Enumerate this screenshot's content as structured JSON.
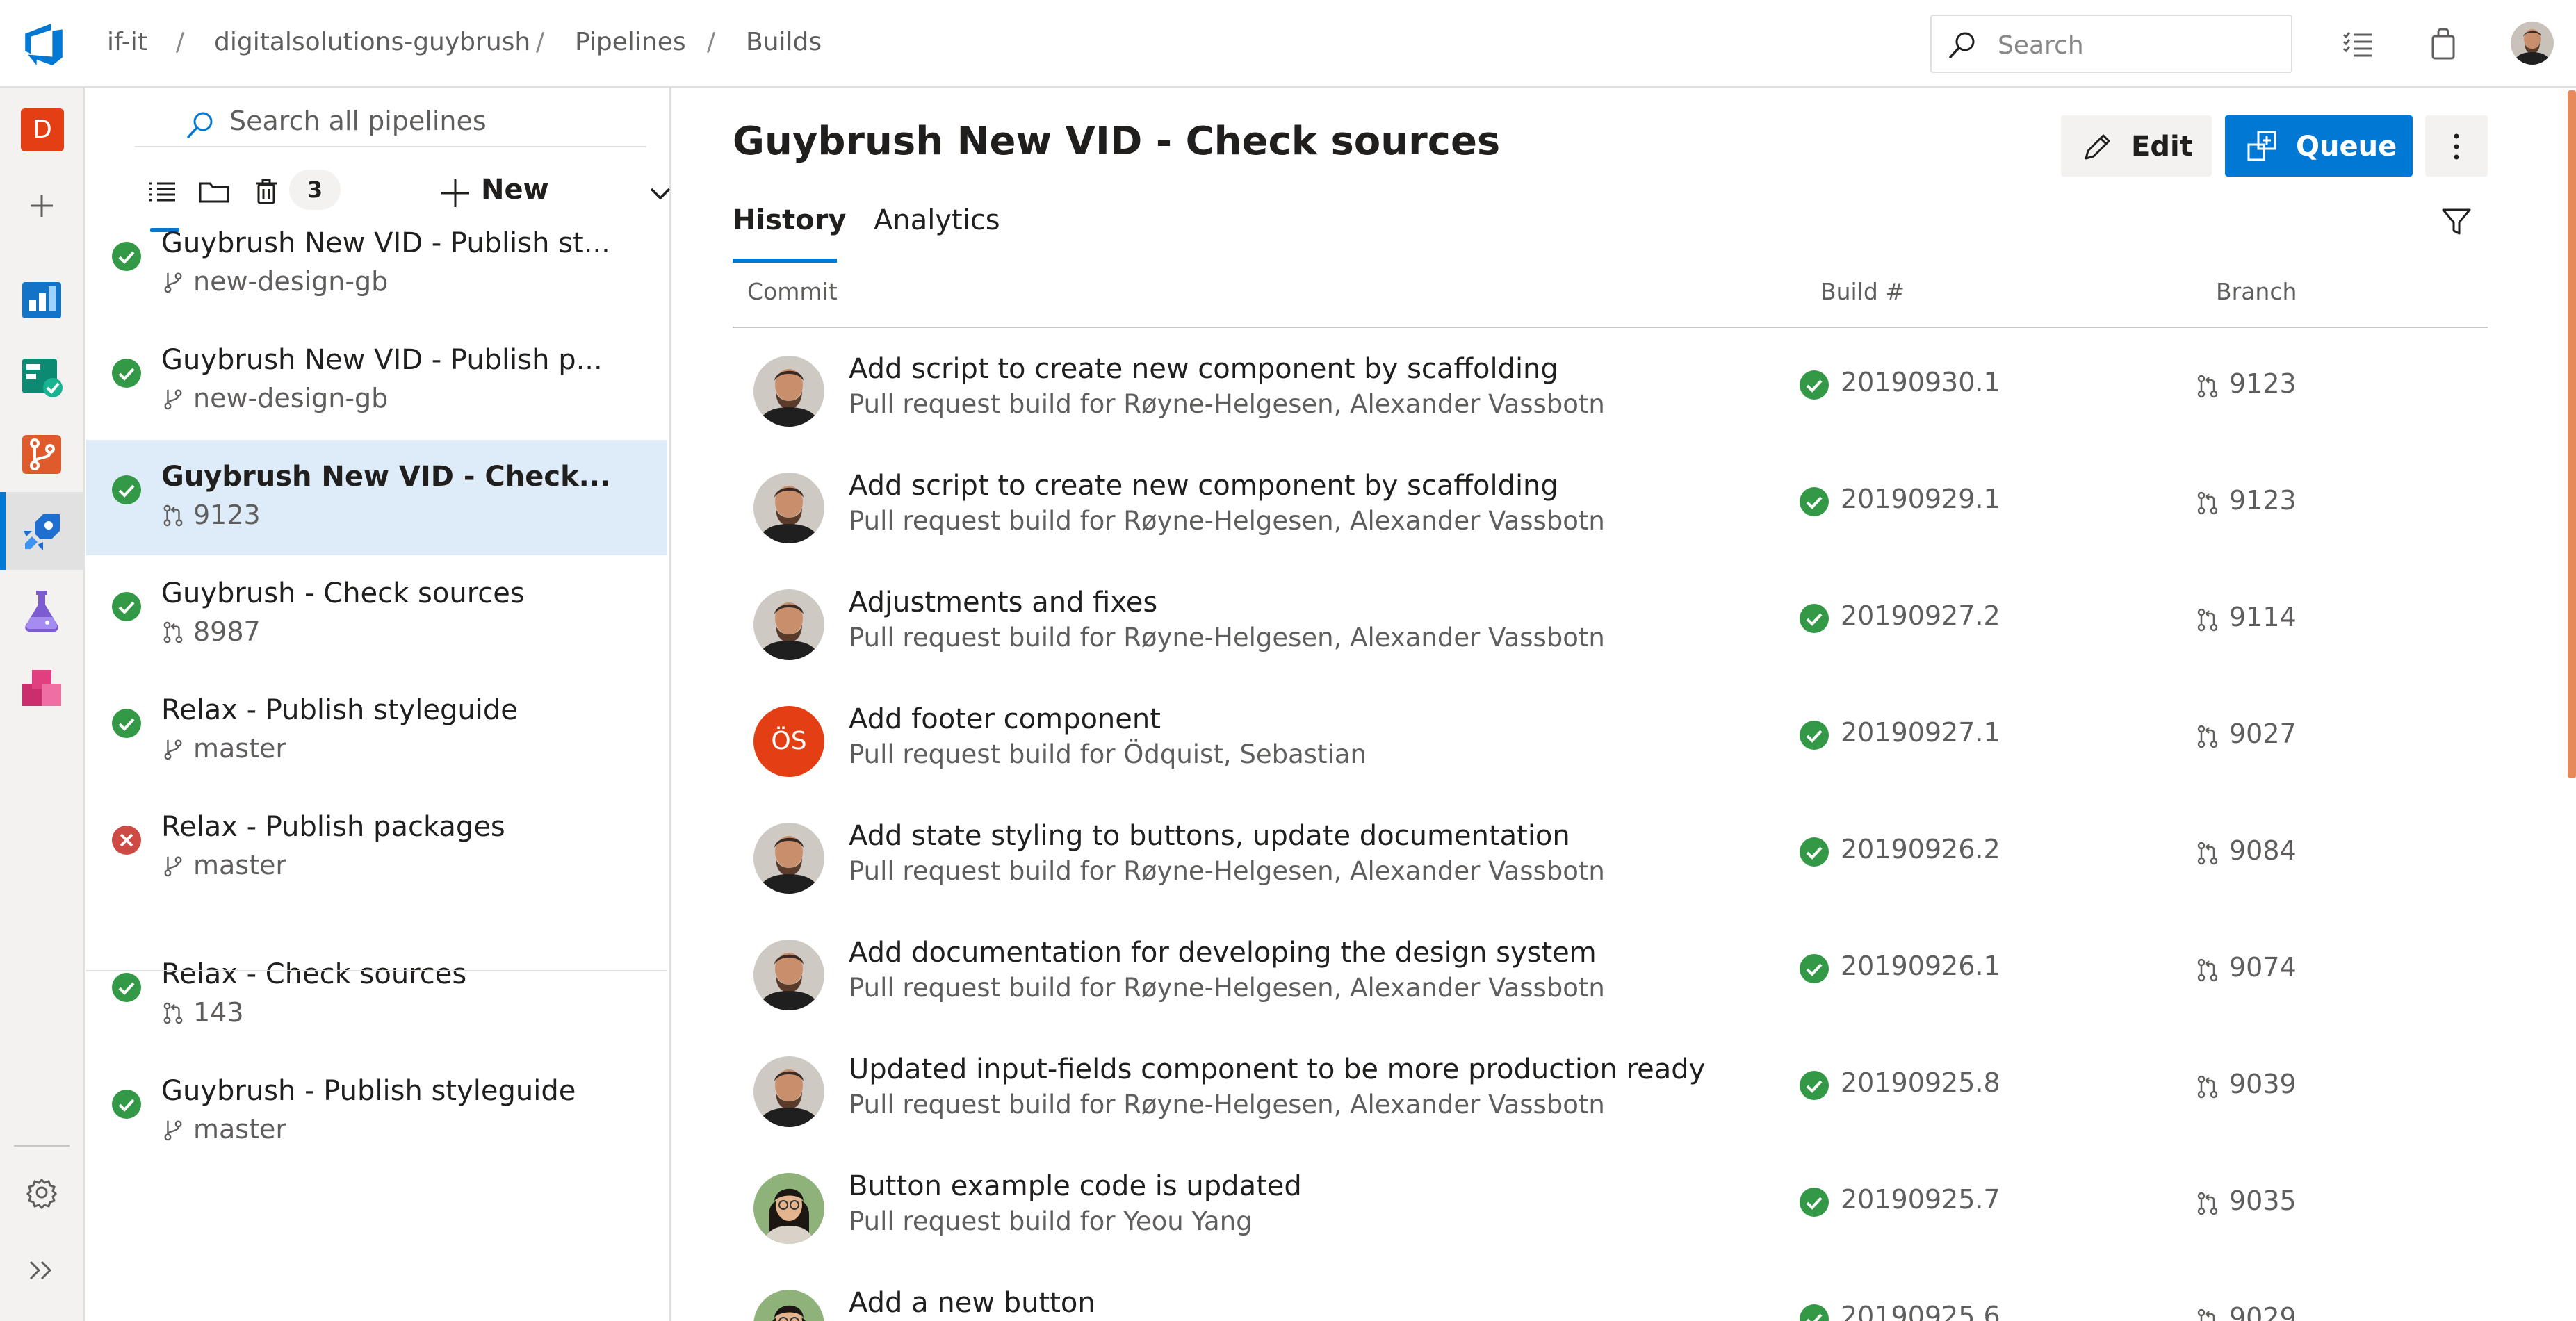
{
  "breadcrumb": {
    "org": "if-it",
    "project": "digitalsolutions-guybrush",
    "section": "Pipelines",
    "page": "Builds"
  },
  "search": {
    "placeholder": "Search"
  },
  "icons": {
    "logo": "azure-devops-logo",
    "search": "search-icon",
    "list": "task-list-icon",
    "bag": "marketplace-bag-icon",
    "avatar": "user-avatar"
  },
  "rail": {
    "org_initial": "D",
    "items": [
      "overview",
      "add",
      "boards",
      "repos-test",
      "repos",
      "pipelines",
      "test-plans",
      "artifacts",
      "settings",
      "expand"
    ]
  },
  "panel": {
    "search_placeholder": "Search all pipelines",
    "deleted_count": "3",
    "new_label": "New",
    "pipelines": [
      {
        "name": "Guybrush New VID - Publish st...",
        "sub": "new-design-gb",
        "sub_type": "branch",
        "status": "success",
        "selected": false
      },
      {
        "name": "Guybrush New VID - Publish p...",
        "sub": "new-design-gb",
        "sub_type": "branch",
        "status": "success",
        "selected": false
      },
      {
        "name": "Guybrush New VID - Check...",
        "sub": "9123",
        "sub_type": "pr",
        "status": "success",
        "selected": true
      },
      {
        "name": "Guybrush - Check sources",
        "sub": "8987",
        "sub_type": "pr",
        "status": "success",
        "selected": false
      },
      {
        "name": "Relax - Publish styleguide",
        "sub": "master",
        "sub_type": "branch",
        "status": "success",
        "selected": false
      },
      {
        "name": "Relax - Publish packages",
        "sub": "master",
        "sub_type": "branch",
        "status": "failed",
        "selected": false
      },
      {
        "name": "Relax - Check sources",
        "sub": "143",
        "sub_type": "pr",
        "status": "success",
        "selected": false
      },
      {
        "name": "Guybrush - Publish styleguide",
        "sub": "master",
        "sub_type": "branch",
        "status": "success",
        "selected": false
      }
    ]
  },
  "main": {
    "title": "Guybrush New VID - Check sources",
    "edit_label": "Edit",
    "queue_label": "Queue",
    "tabs": [
      {
        "label": "History",
        "active": true
      },
      {
        "label": "Analytics",
        "active": false
      }
    ],
    "columns": {
      "commit": "Commit",
      "build": "Build #",
      "branch": "Branch"
    },
    "builds": [
      {
        "title": "Add script to create new component by scaffolding",
        "sub": "Pull request build for Røyne-Helgesen, Alexander Vassbotn",
        "build": "20190930.1",
        "branch": "9123",
        "avatar": "man"
      },
      {
        "title": "Add script to create new component by scaffolding",
        "sub": "Pull request build for Røyne-Helgesen, Alexander Vassbotn",
        "build": "20190929.1",
        "branch": "9123",
        "avatar": "man"
      },
      {
        "title": "Adjustments and fixes",
        "sub": "Pull request build for Røyne-Helgesen, Alexander Vassbotn",
        "build": "20190927.2",
        "branch": "9114",
        "avatar": "man"
      },
      {
        "title": "Add footer component",
        "sub": "Pull request build for Ödquist, Sebastian",
        "build": "20190927.1",
        "branch": "9027",
        "avatar": "initials",
        "initials": "ÖS"
      },
      {
        "title": "Add state styling to buttons, update documentation",
        "sub": "Pull request build for Røyne-Helgesen, Alexander Vassbotn",
        "build": "20190926.2",
        "branch": "9084",
        "avatar": "man"
      },
      {
        "title": "Add documentation for developing the design system",
        "sub": "Pull request build for Røyne-Helgesen, Alexander Vassbotn",
        "build": "20190926.1",
        "branch": "9074",
        "avatar": "man"
      },
      {
        "title": "Updated input-fields component to be more production ready",
        "sub": "Pull request build for Røyne-Helgesen, Alexander Vassbotn",
        "build": "20190925.8",
        "branch": "9039",
        "avatar": "man"
      },
      {
        "title": "Button example code is updated",
        "sub": "Pull request build for Yeou Yang",
        "build": "20190925.7",
        "branch": "9035",
        "avatar": "woman"
      },
      {
        "title": "Add a new button",
        "sub": "",
        "build": "20190925.6",
        "branch": "9029",
        "avatar": "woman"
      }
    ]
  },
  "colors": {
    "accent": "#0078d4",
    "success": "#339947",
    "failed": "#cd4a45",
    "selected_row": "#deecf9"
  }
}
